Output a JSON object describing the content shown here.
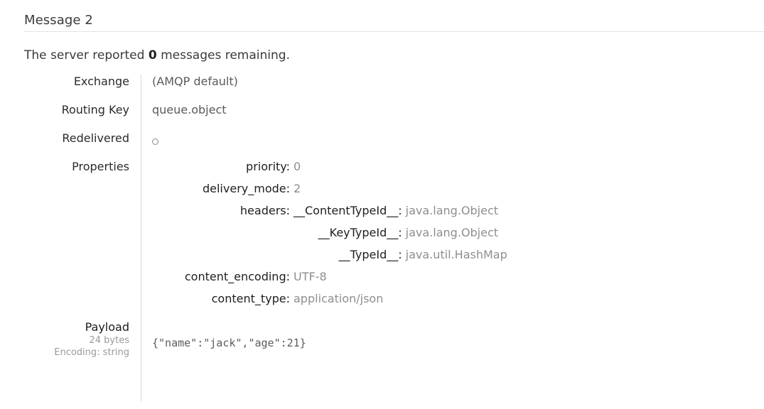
{
  "heading": "Message 2",
  "status": {
    "prefix": "The server reported ",
    "count": "0",
    "suffix": " messages remaining."
  },
  "fields": {
    "exchange_label": "Exchange",
    "exchange_value": "(AMQP default)",
    "routing_key_label": "Routing Key",
    "routing_key_value": "queue.object",
    "redelivered_label": "Redelivered",
    "redelivered_value_icon": "circle-outline-icon",
    "properties_label": "Properties",
    "payload_label": "Payload"
  },
  "properties": [
    {
      "key": "priority:",
      "value": "0"
    },
    {
      "key": "delivery_mode:",
      "value": "2"
    },
    {
      "key": "headers:",
      "value": ""
    },
    {
      "key": "content_encoding:",
      "value": "UTF-8"
    },
    {
      "key": "content_type:",
      "value": "application/json"
    }
  ],
  "headers": [
    {
      "key": "__ContentTypeId__:",
      "value": "java.lang.Object"
    },
    {
      "key": "__KeyTypeId__:",
      "value": "java.lang.Object"
    },
    {
      "key": "__TypeId__:",
      "value": "java.util.HashMap"
    }
  ],
  "payload": {
    "size": "24 bytes",
    "encoding": "Encoding: string",
    "body": "{\"name\":\"jack\",\"age\":21}"
  },
  "colors": {
    "text_primary": "#333333",
    "text_value": "#5a5a5a",
    "text_muted": "#8e8e8e",
    "rule": "#e4e4e4",
    "divider": "#d8d8d8"
  }
}
